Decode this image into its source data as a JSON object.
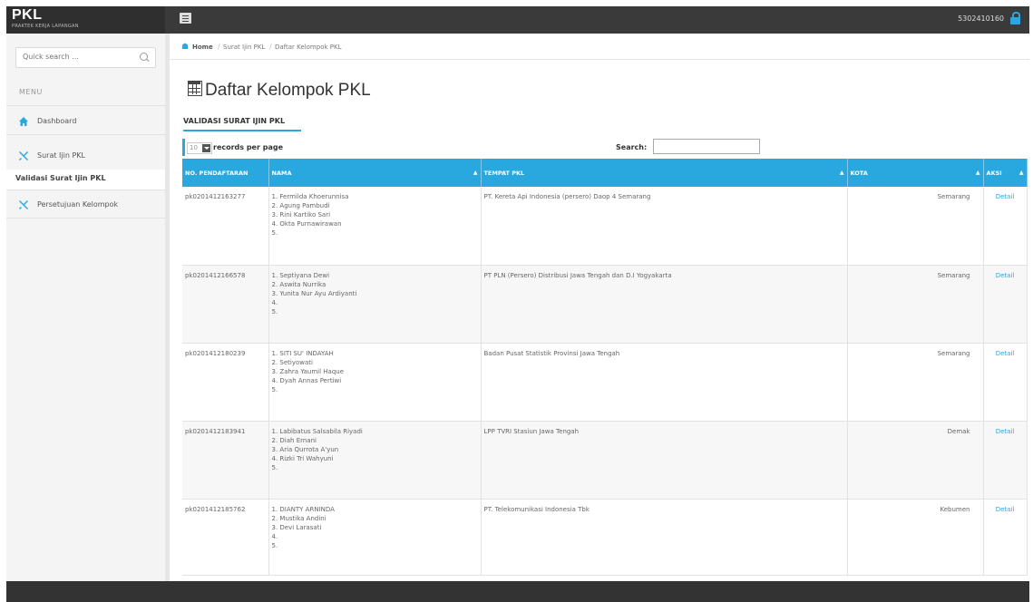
{
  "app": {
    "brand_title": "PKL",
    "brand_subtitle": "PRAKTEK KERJA LAPANGAN",
    "user_id": "5302410160"
  },
  "sidebar": {
    "search_placeholder": "Quick search ...",
    "menu_header": "MENU",
    "items": [
      {
        "label": "Dashboard",
        "icon": "home-icon"
      },
      {
        "label": "Surat Ijin PKL",
        "icon": "tools-icon"
      },
      {
        "label": "Validasi Surat Ijin PKL",
        "icon": ""
      },
      {
        "label": "Persetujuan Kelompok",
        "icon": "tools-icon"
      }
    ]
  },
  "breadcrumb": {
    "items": [
      "Home",
      "Surat Ijin PKL",
      "Daftar Kelompok PKL"
    ]
  },
  "page": {
    "title": "Daftar Kelompok PKL",
    "tab_label": "VALIDASI SURAT IJIN PKL"
  },
  "table_controls": {
    "page_length": "10",
    "records_label": "records per page",
    "search_label": "Search:",
    "search_value": ""
  },
  "table": {
    "headers": {
      "no": "NO. PENDAFTARAN",
      "nama": "NAMA",
      "tempat": "TEMPAT PKL",
      "kota": "KOTA",
      "aksi": "AKSI"
    },
    "rows": [
      {
        "no": "pk0201412163277",
        "nama": [
          "1. Fermilda Khoerunnisa",
          "2. Agung Pambudi",
          "3. Rini Kartiko Sari",
          "4. Okta Purnawirawan",
          "5."
        ],
        "tempat": "PT. Kereta Api Indonesia (persero) Daop 4 Semarang",
        "kota": "Semarang",
        "aksi": "Detail"
      },
      {
        "no": "pk0201412166578",
        "nama": [
          "1. Septiyana Dewi",
          "2. Aswita Nurrika",
          "3. Yunita Nur Ayu Ardiyanti",
          "4.",
          "5."
        ],
        "tempat": "PT PLN (Persero) Distribusi Jawa Tengah dan D.I Yogyakarta",
        "kota": "Semarang",
        "aksi": "Detail"
      },
      {
        "no": "pk0201412180239",
        "nama": [
          "1. SITI SU' INDAYAH",
          "2. Setiyowati",
          "3. Zahra Yaumil Haque",
          "4. Dyah Annas Pertiwi",
          "5."
        ],
        "tempat": "Badan Pusat Statistik Provinsi Jawa Tengah",
        "kota": "Semarang",
        "aksi": "Detail"
      },
      {
        "no": "pk0201412183941",
        "nama": [
          "1. Labibatus Salsabila Riyadi",
          "2. Diah Ernani",
          "3. Aria Qurrota A'yun",
          "4. Rizki Tri Wahyuni",
          "5."
        ],
        "tempat": "LPP TVRI Stasiun Jawa Tengah",
        "kota": "Demak",
        "aksi": "Detail"
      },
      {
        "no": "pk0201412185762",
        "nama": [
          "1. DIANTY ARNINDA",
          "2. Mustika Andini",
          "3. Devi Larasati",
          "4.",
          "5."
        ],
        "tempat": "PT. Telekomunikasi Indonesia Tbk",
        "kota": "Kebumen",
        "aksi": "Detail"
      }
    ]
  },
  "colors": {
    "accent": "#29a8e0",
    "topbar": "#3a3a3a",
    "sidebar_bg": "#f4f4f4"
  }
}
